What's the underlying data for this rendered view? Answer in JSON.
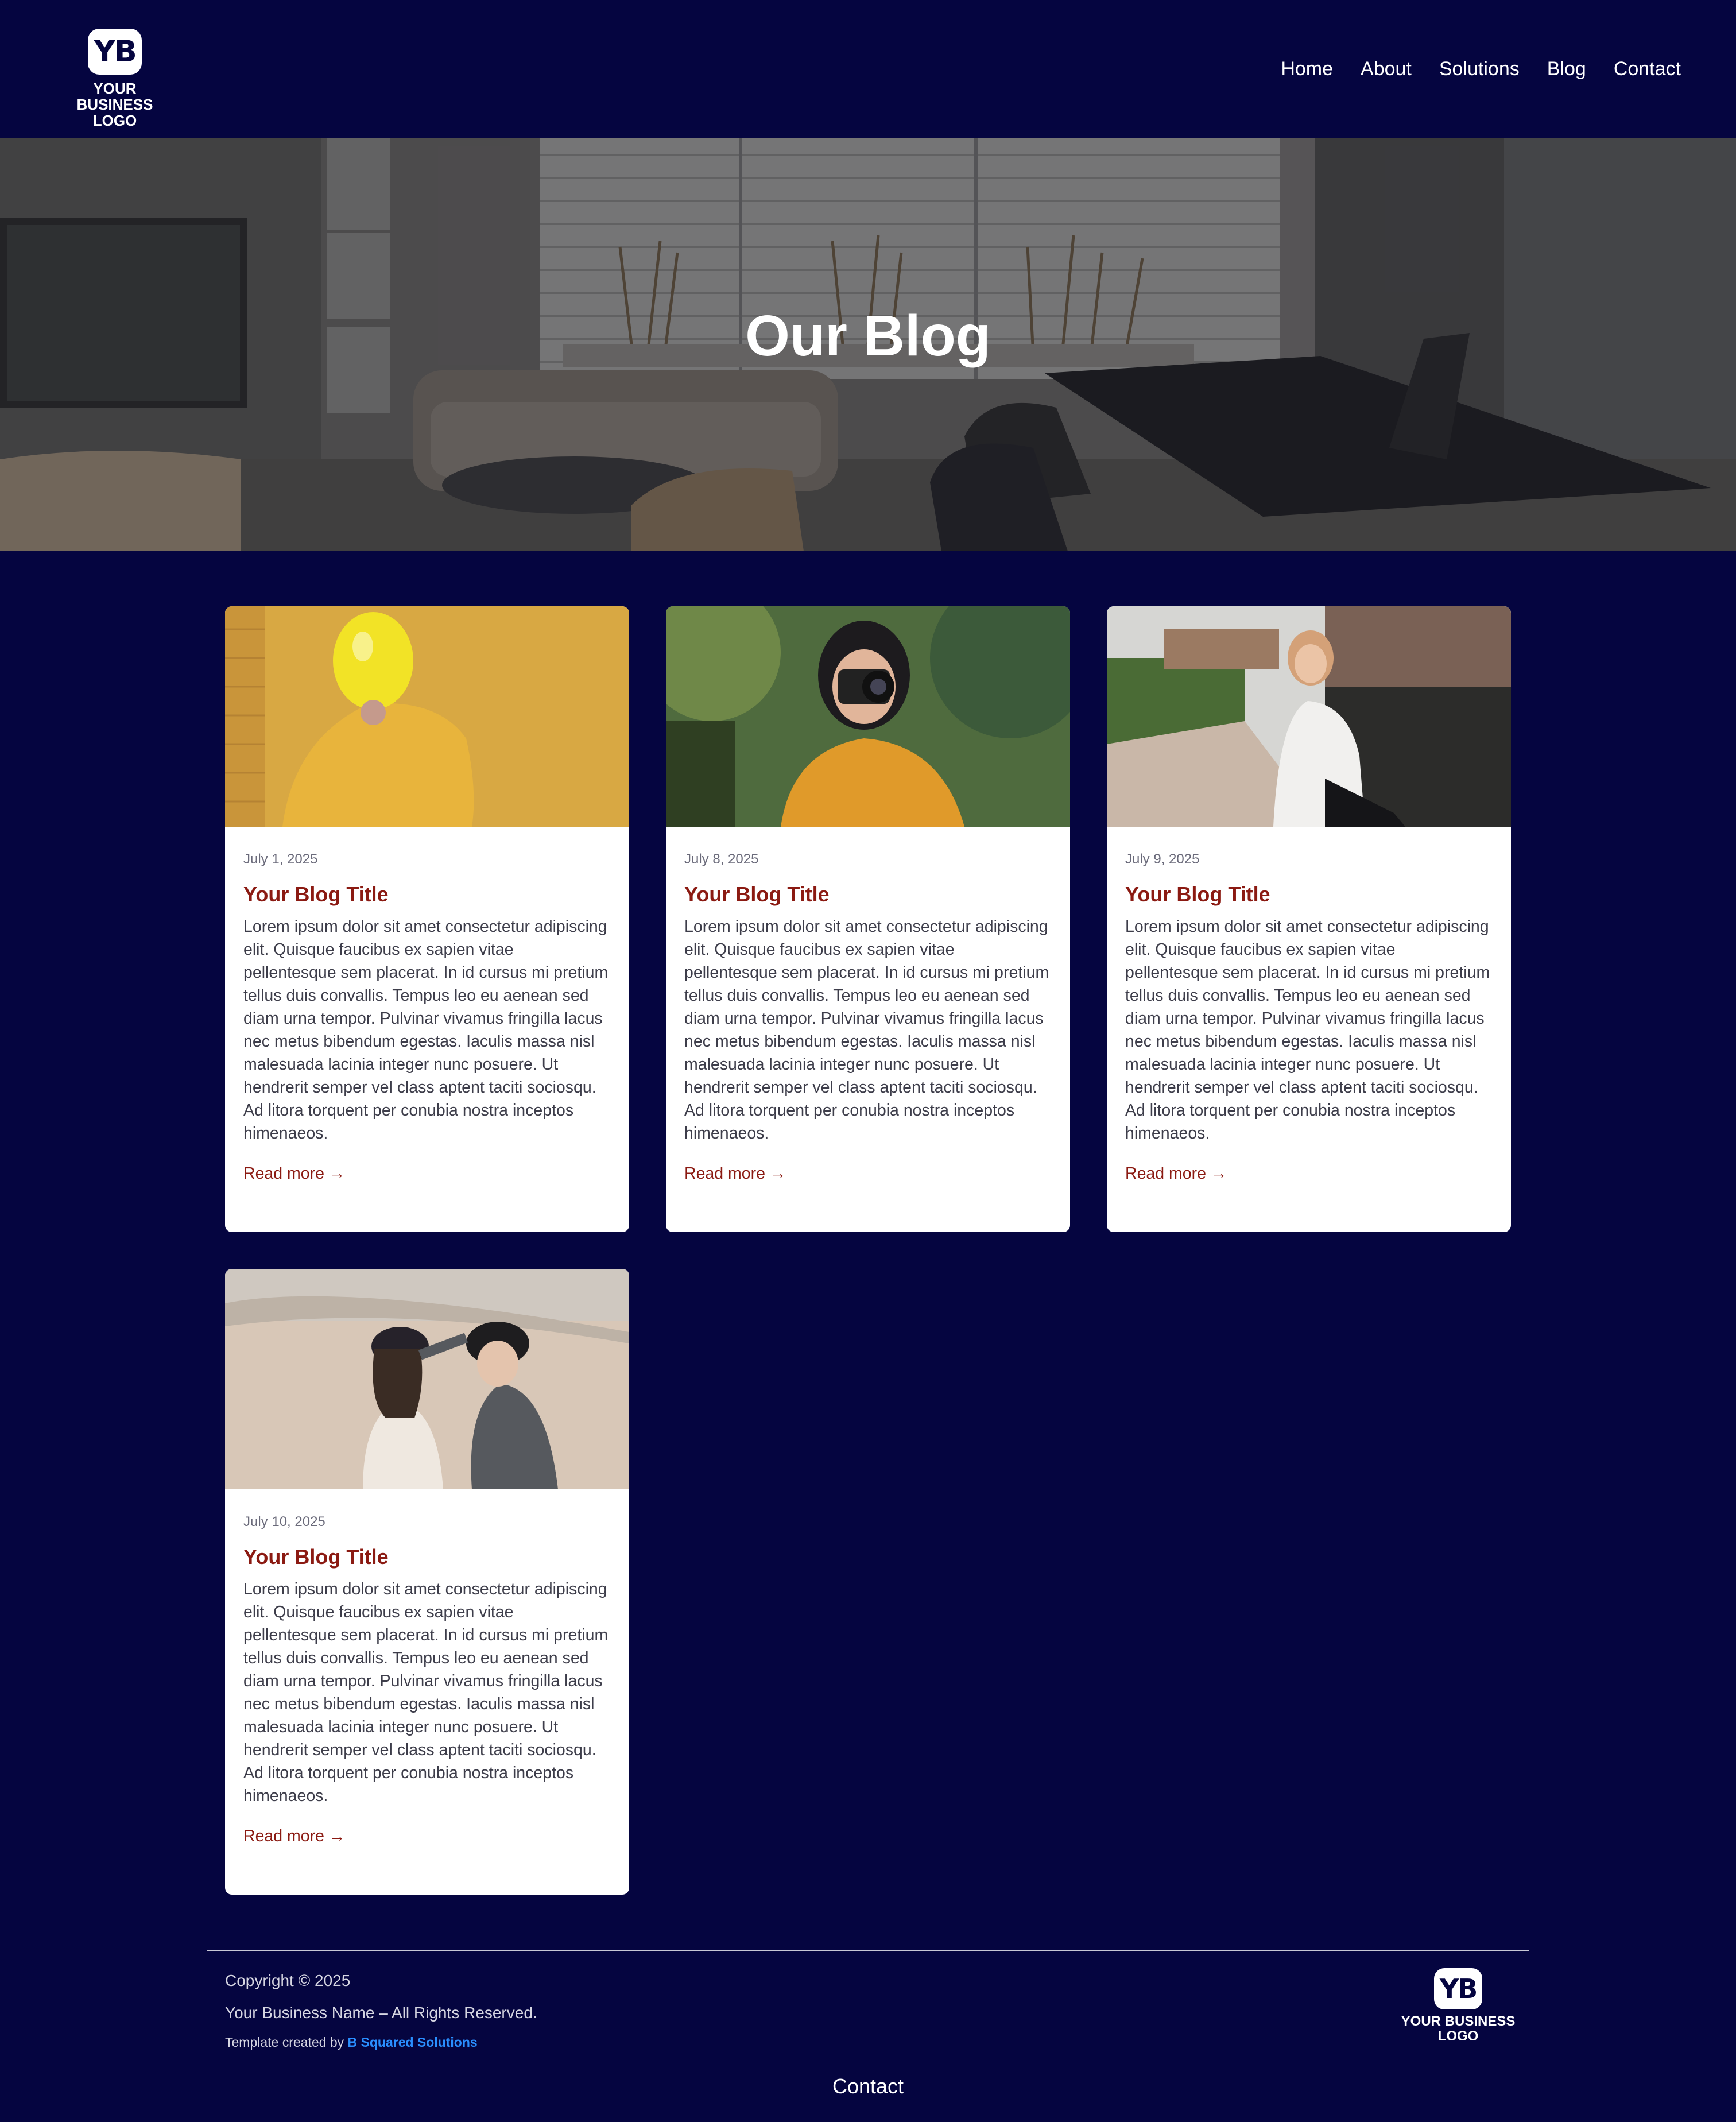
{
  "header": {
    "logo": {
      "mark": "YB",
      "line1": "YOUR BUSINESS",
      "line2": "LOGO"
    },
    "nav": [
      "Home",
      "About",
      "Solutions",
      "Blog",
      "Contact"
    ]
  },
  "hero": {
    "title": "Our Blog"
  },
  "posts": [
    {
      "date": "July 1, 2025",
      "title": "Your Blog Title",
      "excerpt": "Lorem ipsum dolor sit amet consectetur adipiscing elit. Quisque faucibus ex sapien vitae pellentesque sem placerat. In id cursus mi pretium tellus duis convallis. Tempus leo eu aenean sed diam urna tempor. Pulvinar vivamus fringilla lacus nec metus bibendum egestas. Iaculis massa nisl malesuada lacinia integer nunc posuere. Ut hendrerit semper vel class aptent taciti sociosqu. Ad litora torquent per conubia nostra inceptos himenaeos.",
      "read_more": "Read more →"
    },
    {
      "date": "July 8, 2025",
      "title": "Your Blog Title",
      "excerpt": "Lorem ipsum dolor sit amet consectetur adipiscing elit. Quisque faucibus ex sapien vitae pellentesque sem placerat. In id cursus mi pretium tellus duis convallis. Tempus leo eu aenean sed diam urna tempor. Pulvinar vivamus fringilla lacus nec metus bibendum egestas. Iaculis massa nisl malesuada lacinia integer nunc posuere. Ut hendrerit semper vel class aptent taciti sociosqu. Ad litora torquent per conubia nostra inceptos himenaeos.",
      "read_more": "Read more →"
    },
    {
      "date": "July 9, 2025",
      "title": "Your Blog Title",
      "excerpt": "Lorem ipsum dolor sit amet consectetur adipiscing elit. Quisque faucibus ex sapien vitae pellentesque sem placerat. In id cursus mi pretium tellus duis convallis. Tempus leo eu aenean sed diam urna tempor. Pulvinar vivamus fringilla lacus nec metus bibendum egestas. Iaculis massa nisl malesuada lacinia integer nunc posuere. Ut hendrerit semper vel class aptent taciti sociosqu. Ad litora torquent per conubia nostra inceptos himenaeos.",
      "read_more": "Read more →"
    },
    {
      "date": "July 10, 2025",
      "title": "Your Blog Title",
      "excerpt": "Lorem ipsum dolor sit amet consectetur adipiscing elit. Quisque faucibus ex sapien vitae pellentesque sem placerat. In id cursus mi pretium tellus duis convallis. Tempus leo eu aenean sed diam urna tempor. Pulvinar vivamus fringilla lacus nec metus bibendum egestas. Iaculis massa nisl malesuada lacinia integer nunc posuere. Ut hendrerit semper vel class aptent taciti sociosqu. Ad litora torquent per conubia nostra inceptos himenaeos.",
      "read_more": "Read more →"
    }
  ],
  "footer": {
    "copyright": "Copyright © 2025",
    "rights": "Your Business Name – All Rights Reserved.",
    "credit_prefix": "Template created by ",
    "credit_link": "B Squared Solutions",
    "logo": {
      "mark": "YB",
      "line1": "YOUR BUSINESS",
      "line2": "LOGO"
    },
    "contact": "Contact"
  },
  "colors": {
    "background": "#050540",
    "accent": "#8b1a12",
    "link": "#2a8fff"
  }
}
